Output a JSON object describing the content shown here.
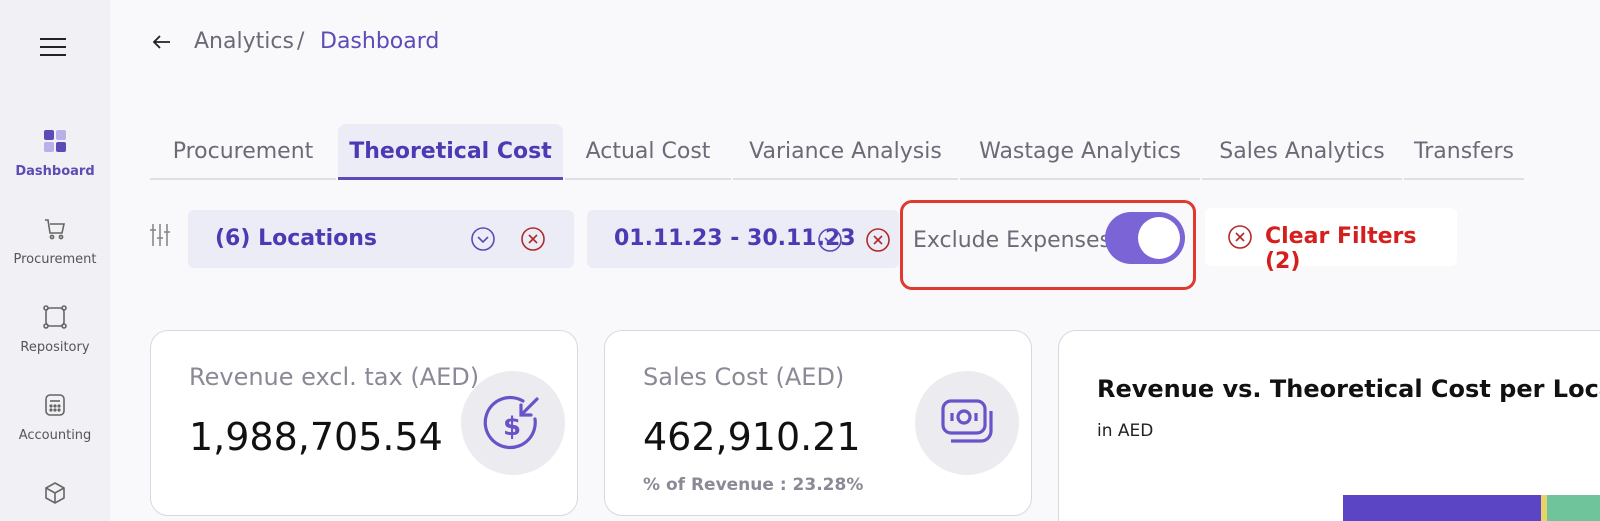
{
  "sidebar": {
    "items": [
      {
        "label": "Dashboard",
        "icon": "dashboard-icon",
        "active": true
      },
      {
        "label": "Procurement",
        "icon": "cart-icon"
      },
      {
        "label": "Repository",
        "icon": "repository-icon"
      },
      {
        "label": "Accounting",
        "icon": "calculator-icon"
      },
      {
        "label": "",
        "icon": "box-icon"
      }
    ]
  },
  "breadcrumb": {
    "parent": "Analytics",
    "separator": "/",
    "current": "Dashboard"
  },
  "tabs": [
    {
      "label": "Procurement"
    },
    {
      "label": "Theoretical Cost",
      "active": true
    },
    {
      "label": "Actual Cost"
    },
    {
      "label": "Variance Analysis"
    },
    {
      "label": "Wastage Analytics"
    },
    {
      "label": "Sales Analytics"
    },
    {
      "label": "Transfers"
    }
  ],
  "filters": {
    "locations": "(6) Locations",
    "date_range": "01.11.23 - 30.11.23",
    "exclude_expenses_label": "Exclude Expenses",
    "exclude_expenses_on": true,
    "clear_label": "Clear Filters (2)"
  },
  "cards": {
    "revenue": {
      "title": "Revenue excl. tax (AED)",
      "value": "1,988,705.54",
      "icon": "dollar-arrow-icon"
    },
    "sales_cost": {
      "title": "Sales Cost (AED)",
      "value": "462,910.21",
      "sub": "% of Revenue : 23.28%",
      "icon": "cash-stack-icon"
    }
  },
  "chart": {
    "title": "Revenue vs. Theoretical Cost per Location",
    "subtitle": "in AED"
  },
  "colors": {
    "accent": "#5b4bb7",
    "toggle": "#7a64d6",
    "danger": "#d41f1f",
    "bar_purple": "#5b45c4",
    "bar_yellow": "#e8d36a",
    "bar_green": "#6fc49b"
  }
}
